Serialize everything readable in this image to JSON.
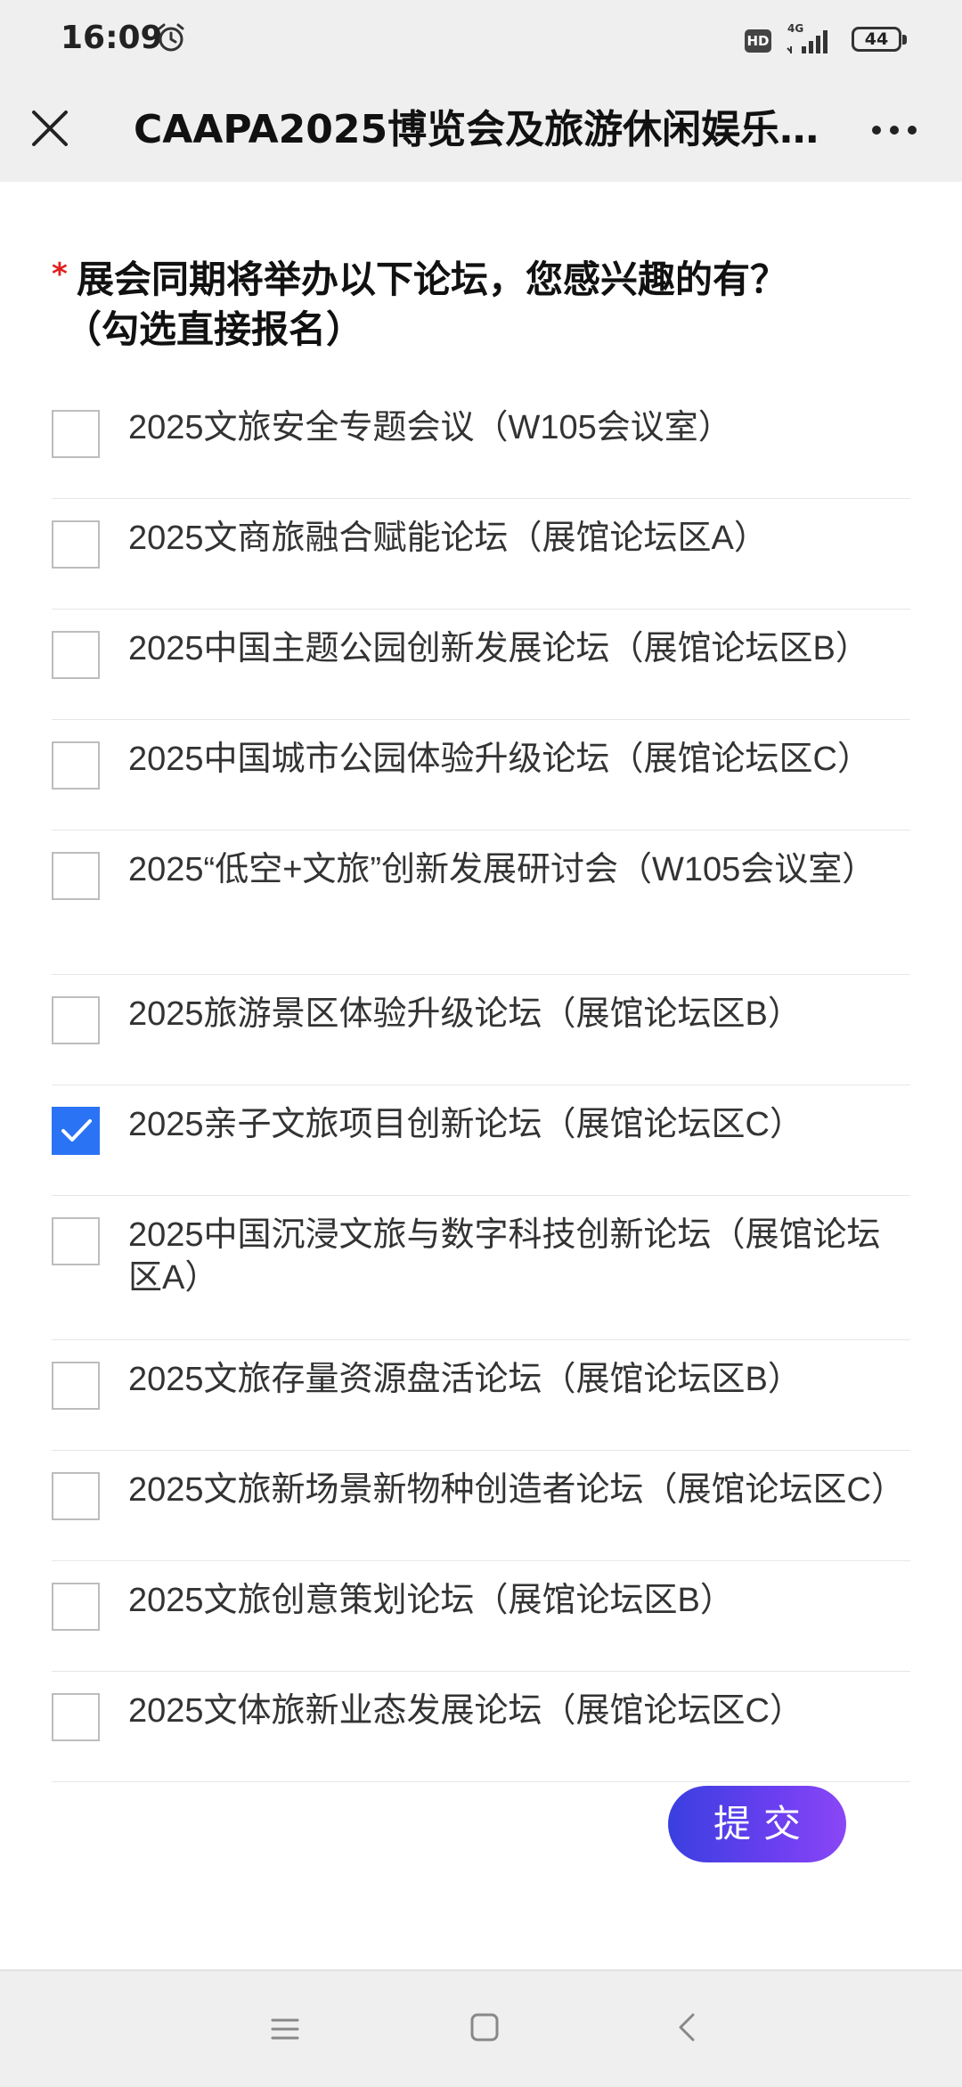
{
  "status_bar": {
    "time": "16:09",
    "hd_label": "HD",
    "network_label": "4G",
    "battery_level": "44",
    "icons": [
      "alarm-icon",
      "signal-icon",
      "battery-icon"
    ]
  },
  "header": {
    "title": "CAAPA2025博览会及旅游休闲娱乐...",
    "close_icon": "close-icon",
    "more_icon": "more-horizontal-icon"
  },
  "form": {
    "required_mark": "*",
    "question_line1": "展会同期将举办以下论坛，您感兴趣的有？",
    "question_line2": "（勾选直接报名）",
    "options": [
      {
        "label": "2025文旅安全专题会议（W105会议室）",
        "checked": false
      },
      {
        "label": "2025文商旅融合赋能论坛（展馆论坛区A）",
        "checked": false
      },
      {
        "label": "2025中国主题公园创新发展论坛（展馆论坛区B）",
        "checked": false
      },
      {
        "label": "2025中国城市公园体验升级论坛（展馆论坛区C）",
        "checked": false
      },
      {
        "label": "2025“低空+文旅”创新发展研讨会（W105会议室）",
        "checked": false
      },
      {
        "label": "2025旅游景区体验升级论坛（展馆论坛区B）",
        "checked": false
      },
      {
        "label": "2025亲子文旅项目创新论坛（展馆论坛区C）",
        "checked": true
      },
      {
        "label": "2025中国沉浸文旅与数字科技创新论坛（展馆论坛区A）",
        "checked": false
      },
      {
        "label": "2025文旅存量资源盘活论坛（展馆论坛区B）",
        "checked": false
      },
      {
        "label": "2025文旅新场景新物种创造者论坛（展馆论坛区C）",
        "checked": false
      },
      {
        "label": "2025文旅创意策划论坛（展馆论坛区B）",
        "checked": false
      },
      {
        "label": "2025文体旅新业态发展论坛（展馆论坛区C）",
        "checked": false
      }
    ],
    "submit_label": "提交"
  },
  "bottom_nav": {
    "icons": [
      "menu-icon",
      "home-icon",
      "back-icon"
    ]
  },
  "colors": {
    "accent": "#2a73f5",
    "required": "#e02020",
    "submit_gradient_start": "#3a3fe0",
    "submit_gradient_end": "#8a47f5",
    "bar_background": "#efefef"
  }
}
